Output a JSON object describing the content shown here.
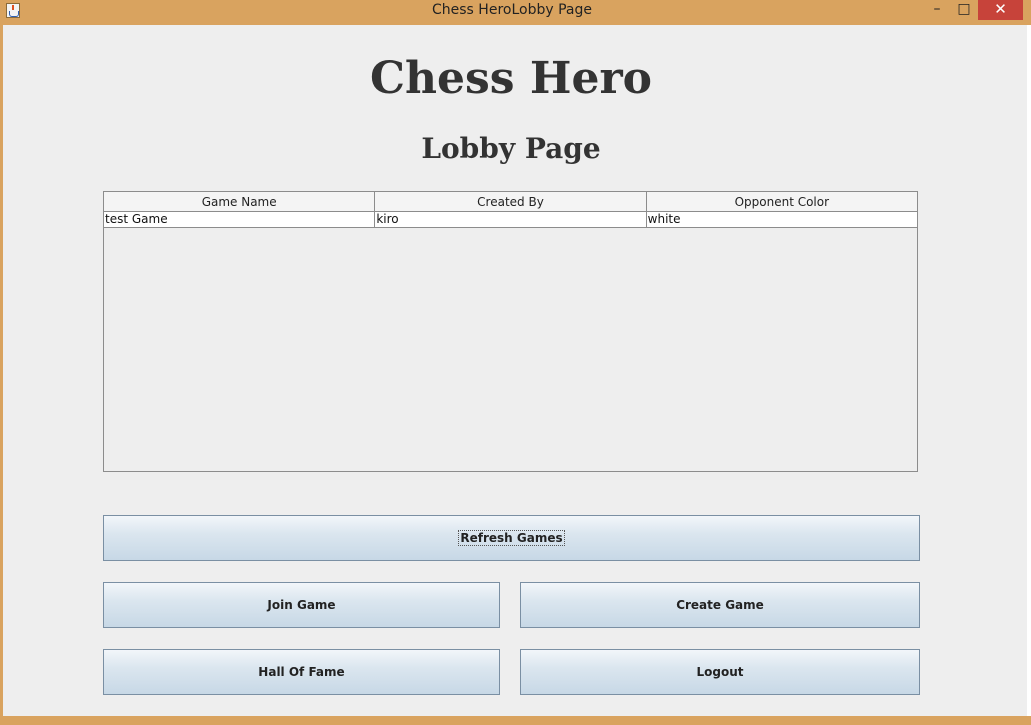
{
  "window": {
    "title": "Chess HeroLobby Page",
    "minimize_glyph": "–",
    "maximize_glyph": "□",
    "close_glyph": "✕",
    "frame_color": "#d9a35f",
    "close_color": "#c7433a"
  },
  "page": {
    "heading": "Chess Hero",
    "subheading": "Lobby Page"
  },
  "table": {
    "columns": [
      "Game Name",
      "Created By",
      "Opponent Color"
    ],
    "rows": [
      [
        "test Game",
        "kiro",
        "white"
      ]
    ]
  },
  "buttons": {
    "refresh": "Refresh Games",
    "join": "Join Game",
    "create": "Create Game",
    "hall_of_fame": "Hall Of Fame",
    "logout": "Logout"
  }
}
